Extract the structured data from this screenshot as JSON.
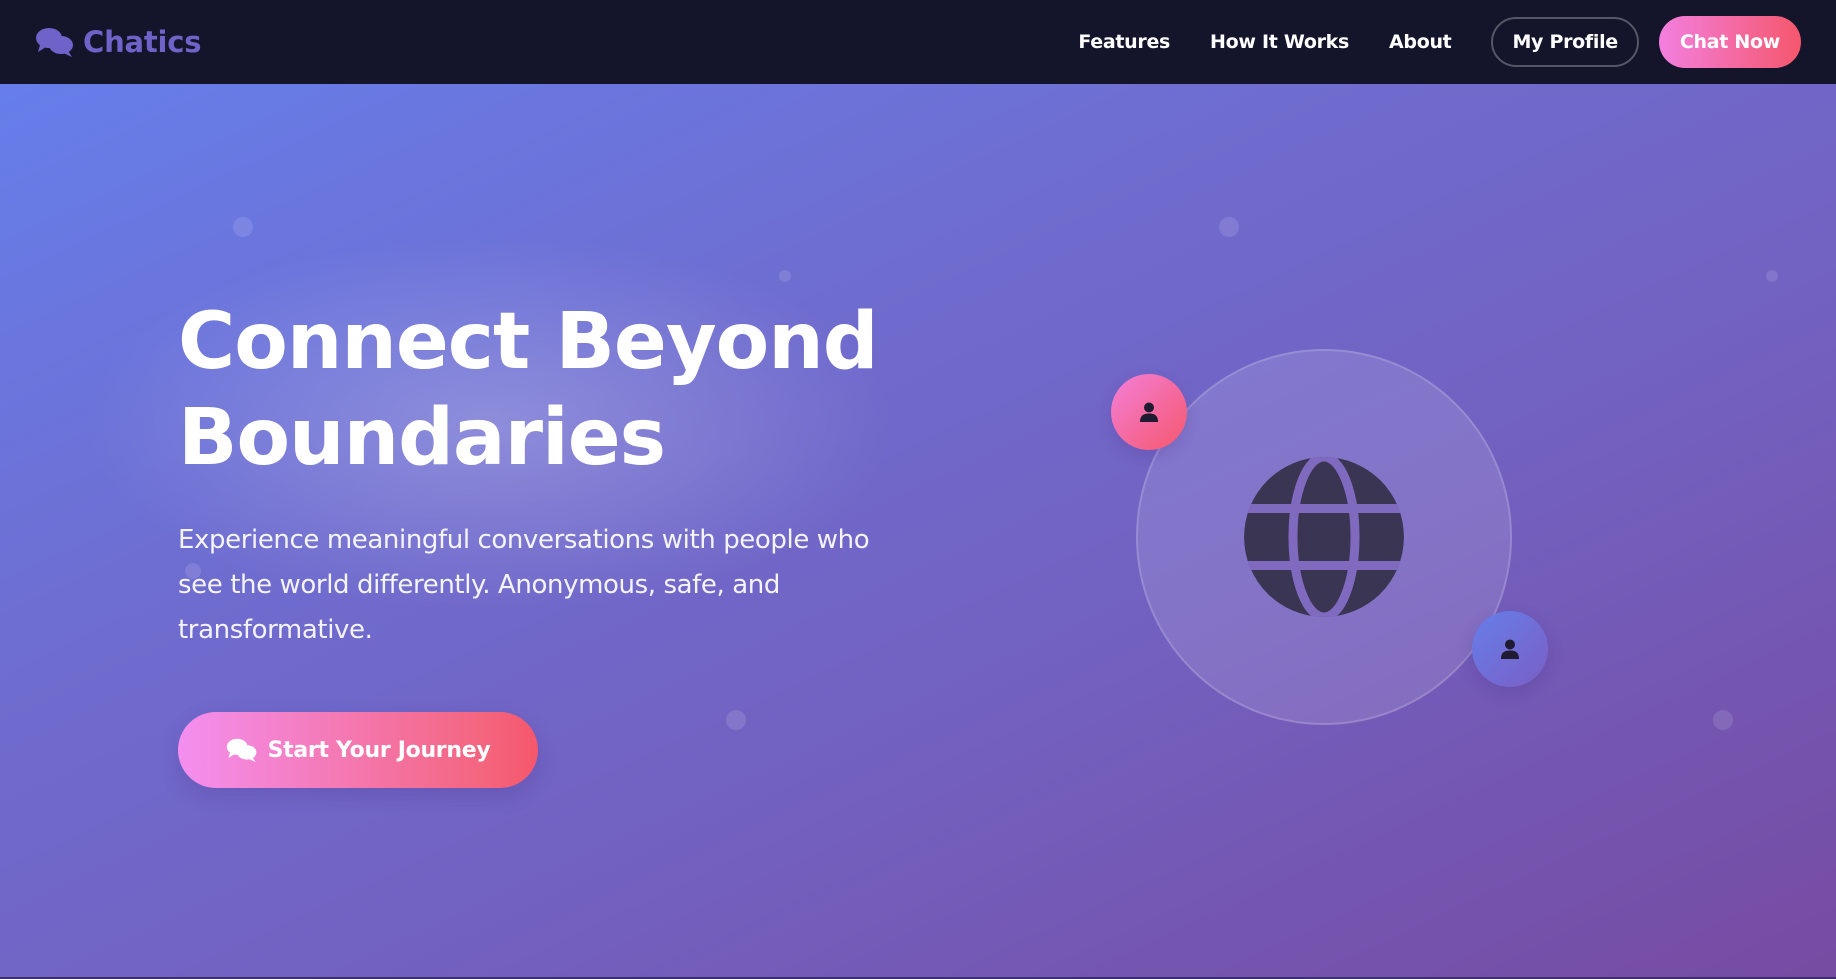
{
  "brand": {
    "name": "Chatics",
    "icon": "comments-icon"
  },
  "nav": {
    "links": [
      "Features",
      "How It Works",
      "About"
    ],
    "profile_label": "My Profile",
    "chat_label": "Chat Now"
  },
  "hero": {
    "title_line1": "Connect Beyond",
    "title_line2": "Boundaries",
    "subtitle": "Experience meaningful conversations with people who see the world differently. Anonymous, safe, and transformative.",
    "cta_label": "Start Your Journey",
    "cta_icon": "comments-icon"
  },
  "illustration": {
    "center_icon": "globe-icon",
    "avatar_icons": [
      "user-icon",
      "user-icon"
    ]
  },
  "colors": {
    "nav_bg": "#14152b",
    "brand": "#6f63c9",
    "gradient_start": "#667eea",
    "gradient_end": "#764ba2",
    "accent_pink": "#f093fb",
    "accent_red": "#f5576c"
  }
}
